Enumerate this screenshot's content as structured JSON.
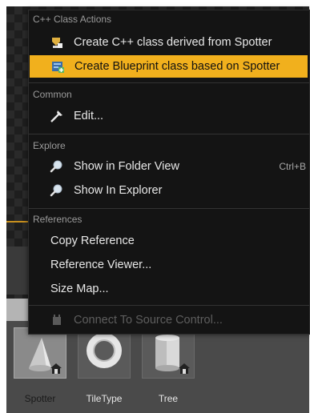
{
  "menu": {
    "sections": {
      "cpp": {
        "header": "C++ Class Actions",
        "items": [
          {
            "label": "Create C++ class derived from Spotter",
            "icon": "cpp-class-icon"
          },
          {
            "label": "Create Blueprint class based on Spotter",
            "icon": "blueprint-class-icon"
          }
        ]
      },
      "common": {
        "header": "Common",
        "items": [
          {
            "label": "Edit...",
            "icon": "edit-icon"
          }
        ]
      },
      "explore": {
        "header": "Explore",
        "items": [
          {
            "label": "Show in Folder View",
            "icon": "search-icon",
            "shortcut": "Ctrl+B"
          },
          {
            "label": "Show In Explorer",
            "icon": "search-icon"
          }
        ]
      },
      "references": {
        "header": "References",
        "items": [
          {
            "label": "Copy Reference"
          },
          {
            "label": "Reference Viewer..."
          },
          {
            "label": "Size Map..."
          },
          {
            "label": "Connect To Source Control...",
            "icon": "source-control-icon",
            "disabled": true
          }
        ]
      }
    }
  },
  "content_browser": {
    "assets": [
      {
        "label": "Spotter",
        "selected": true,
        "shape": "cone"
      },
      {
        "label": "TileType",
        "selected": false,
        "shape": "torus"
      },
      {
        "label": "Tree",
        "selected": false,
        "shape": "cylinder"
      }
    ]
  },
  "colors": {
    "highlight": "#f1b01d",
    "menu_bg": "#141414",
    "accent_line": "#c8901e"
  }
}
